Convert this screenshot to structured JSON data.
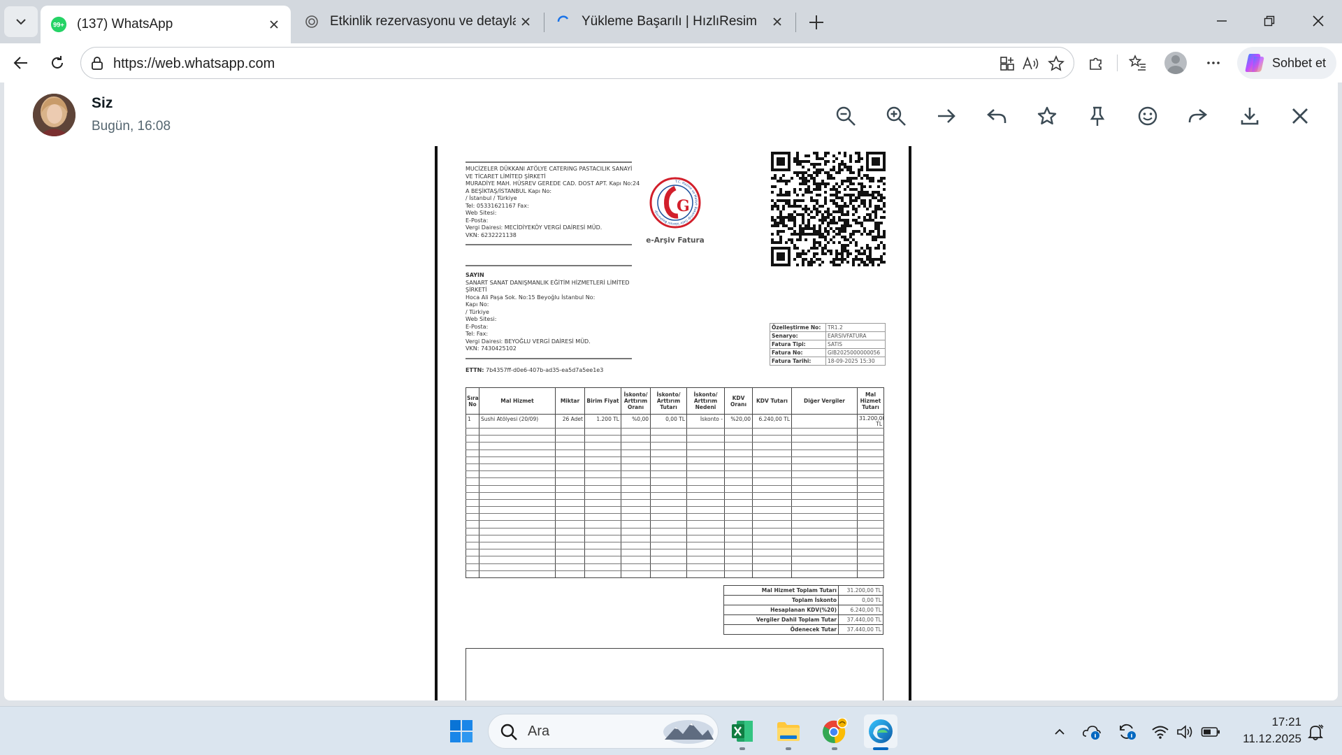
{
  "tabs": [
    {
      "title": "(137) WhatsApp",
      "badge": "99+",
      "icon": "whatsapp-icon"
    },
    {
      "title": "Etkinlik rezervasyonu ve detaylar",
      "icon": "chatgpt-icon"
    },
    {
      "title": "Yükleme Başarılı | HızlıResim",
      "icon": "loading-icon"
    }
  ],
  "address_bar": {
    "url": "https://web.whatsapp.com"
  },
  "copilot": {
    "label": "Sohbet et"
  },
  "viewer": {
    "sender": "Siz",
    "timestamp": "Bugün, 16:08"
  },
  "invoice": {
    "seller_lines": [
      "MUCİZELER DÜKKANI ATÖLYE CATERING PASTACILIK SANAYİ",
      "VE TİCARET LİMİTED ŞİRKETİ",
      "MURADİYE MAH. HÜSREV GEREDE CAD. DOST APT. Kapı No:24",
      "A BEŞİKTAŞ/İSTANBUL  Kapı No:",
      " / İstanbul / Türkiye",
      "Tel: 05331621167 Fax:",
      "Web Sitesi:",
      "E-Posta:",
      "Vergi Dairesi: MECİDİYEKÖY VERGİ DAİRESİ MÜD.",
      "VKN: 6232221138"
    ],
    "buyer_title": "SAYIN",
    "buyer_lines": [
      "SANART SANAT DANIŞMANLIK EĞİTİM HİZMETLERİ LİMİTED",
      "ŞİRKETİ",
      "Hoca Ali Paşa Sok. No:15 Beyoğlu İstanbul  No:",
      "Kapı No:",
      " /  Türkiye",
      "Web Sitesi:",
      "E-Posta:",
      "Tel: Fax:",
      "Vergi Dairesi: BEYOĞLU VERGİ DAİRESİ MÜD.",
      "VKN: 7430425102"
    ],
    "logo_caption": "e-Arşiv Fatura",
    "logo_ring_text": "T.C. Hazine ve Maliye Bakanlığı Gelir İdaresi Başkanlığı",
    "logo_letter": "G",
    "meta": [
      {
        "key": "Özelleştirme No:",
        "value": "TR1.2"
      },
      {
        "key": "Senaryo:",
        "value": "EARSIVFATURA"
      },
      {
        "key": "Fatura Tipi:",
        "value": "SATIS"
      },
      {
        "key": "Fatura No:",
        "value": "GIB2025000000056"
      },
      {
        "key": "Fatura Tarihi:",
        "value": "18-09-2025 15:30"
      }
    ],
    "ettn_label": "ETTN:",
    "ettn_value": "7b4357ff-d0e6-407b-ad35-ea5d7a5ee1e3",
    "columns": [
      "Sıra No",
      "Mal Hizmet",
      "Miktar",
      "Birim Fiyat",
      "İskonto/ Arttırım Oranı",
      "İskonto/ Arttırım Tutarı",
      "İskonto/ Arttırım Nedeni",
      "KDV Oranı",
      "KDV Tutarı",
      "Diğer Vergiler",
      "Mal Hizmet Tutarı"
    ],
    "rows": [
      [
        "1",
        "Sushi Atölyesi (20/09)",
        "26 Adet",
        "1.200 TL",
        "%0,00",
        "0,00 TL",
        "İskonto -",
        "%20,00",
        "6.240,00 TL",
        "",
        "31.200,00 TL"
      ]
    ],
    "totals": [
      {
        "key": "Mal Hizmet Toplam Tutarı",
        "value": "31.200,00 TL"
      },
      {
        "key": "Toplam İskonto",
        "value": "0,00 TL"
      },
      {
        "key": "Hesaplanan KDV(%20)",
        "value": "6.240,00 TL"
      },
      {
        "key": "Vergiler Dahil Toplam Tutar",
        "value": "37.440,00 TL"
      },
      {
        "key": "Ödenecek Tutar",
        "value": "37.440,00 TL"
      }
    ]
  },
  "taskbar": {
    "search_placeholder": "Ara",
    "apps": [
      "windows-start-icon",
      "excel-icon",
      "file-explorer-icon",
      "chrome-icon",
      "edge-icon"
    ]
  },
  "clock": {
    "time": "17:21",
    "date": "11.12.2025"
  }
}
